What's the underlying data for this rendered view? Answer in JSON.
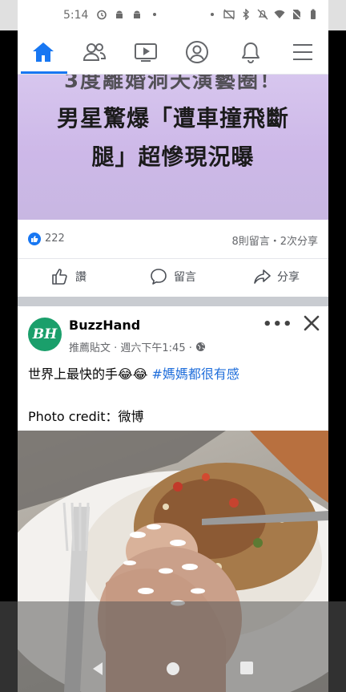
{
  "status_bar": {
    "time": "5:14"
  },
  "nav": {
    "items": [
      "home-icon",
      "friends-icon",
      "watch-icon",
      "profile-icon",
      "notifications-icon",
      "menu-icon"
    ],
    "accent": "#1877f2"
  },
  "post1": {
    "headline_cut": "3度離婚洞天演藝圈！",
    "headline_1": "男星驚爆「遭車撞飛斷",
    "headline_2": "腿」超慘現況曝",
    "like_count": "222",
    "comments_shares": "8則留言・2次分享",
    "actions": {
      "like": "讚",
      "comment": "留言",
      "share": "分享"
    }
  },
  "post2": {
    "avatar_text": "BH",
    "page_name": "BuzzHand",
    "meta_text": "推薦貼文 · 週六下午1:45 ·",
    "text_main": "世界上最快的手😂😂 ",
    "hashtag": "#媽媽都很有感",
    "credit": "Photo credit：微博",
    "avatar_color": "#1a9f6b"
  }
}
